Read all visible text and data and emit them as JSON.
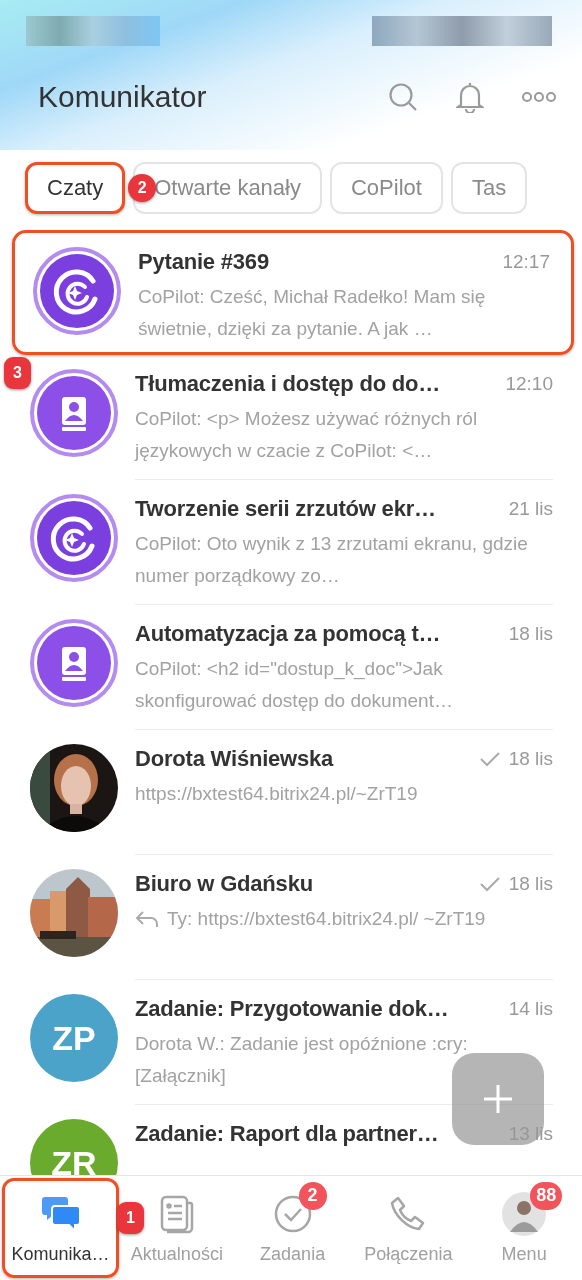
{
  "header": {
    "title": "Komunikator"
  },
  "chips": [
    {
      "label": "Czaty",
      "selected": true,
      "highlighted": true,
      "callout": "2"
    },
    {
      "label": "Otwarte kanały",
      "selected": false,
      "highlighted": false
    },
    {
      "label": "CoPilot",
      "selected": false,
      "highlighted": false
    },
    {
      "label": "Tas",
      "selected": false,
      "highlighted": false
    }
  ],
  "chats": [
    {
      "avatar": {
        "kind": "copilot"
      },
      "title": "Pytanie #369",
      "time": "12:17",
      "preview": "CoPilot: Cześć, Michał Radełko! Mam się świetnie, dzięki za pytanie. A jak …",
      "read": false,
      "reply": false,
      "highlighted": true,
      "callout": "3"
    },
    {
      "avatar": {
        "kind": "book"
      },
      "title": "Tłumaczenia i dostęp do do…",
      "time": "12:10",
      "preview": "CoPilot: <p>  Możesz używać różnych ról językowych w czacie z CoPilot: <…",
      "read": false,
      "reply": false,
      "highlighted": false
    },
    {
      "avatar": {
        "kind": "copilot"
      },
      "title": "Tworzenie serii zrzutów ekr…",
      "time": "21 lis",
      "preview": "CoPilot: Oto wynik z 13 zrzutami ekranu, gdzie numer porządkowy zo…",
      "read": false,
      "reply": false,
      "highlighted": false
    },
    {
      "avatar": {
        "kind": "book"
      },
      "title": "Automatyzacja za pomocą t…",
      "time": "18 lis",
      "preview": "CoPilot: <h2 id=\"dostup_k_doc\">Jak skonfigurować dostęp do dokument…",
      "read": false,
      "reply": false,
      "highlighted": false
    },
    {
      "title": "Dorota Wiśniewska",
      "time": "18 lis",
      "preview": "https://bxtest64.bitrix24.pl/~ZrT19",
      "read": true,
      "reply": false,
      "highlighted": false
    },
    {
      "title": "Biuro w Gdańsku",
      "time": "18 lis",
      "preview": "Ty: https://bxtest64.bitrix24.pl/ ~ZrT19",
      "read": true,
      "reply": true,
      "highlighted": false
    },
    {
      "avatar": {
        "kind": "initials",
        "initials": "ZP",
        "color": "#4ba3c9"
      },
      "title": "Zadanie: Przygotowanie dok…",
      "time": "14 lis",
      "preview": "Dorota W.: Zadanie jest opóźnione :cry: [Załącznik]",
      "read": false,
      "reply": false,
      "highlighted": false
    },
    {
      "avatar": {
        "kind": "initials",
        "initials": "ZR",
        "color": "#6aab2e"
      },
      "title": "Zadanie: Raport dla partner…",
      "time": "13 lis",
      "read": false,
      "reply": false,
      "highlighted": false
    }
  ],
  "nav": [
    {
      "label": "Komunika…",
      "selected": true,
      "highlighted": true,
      "callout": "1"
    },
    {
      "label": "Aktualności",
      "selected": false,
      "highlighted": false
    },
    {
      "label": "Zadania",
      "selected": false,
      "highlighted": false,
      "badge": "2"
    },
    {
      "label": "Połączenia",
      "selected": false,
      "highlighted": false
    },
    {
      "label": "Menu",
      "selected": false,
      "highlighted": false,
      "badge": "88"
    }
  ]
}
